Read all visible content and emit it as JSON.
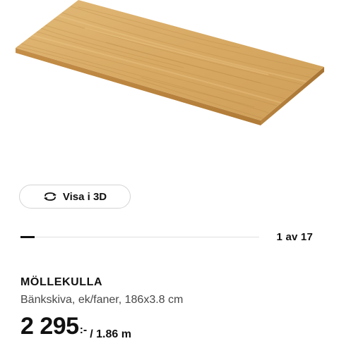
{
  "product_image": {
    "alt": "oak worktop"
  },
  "view_3d": {
    "label": "Visa i 3D",
    "icon": "rotate-3d-icon"
  },
  "carousel": {
    "counter": "1 av 17",
    "current": 1,
    "total": 17
  },
  "product": {
    "name": "MÖLLEKULLA",
    "description": "Bänkskiva, ek/faner, 186x3.8 cm",
    "price_amount": "2 295",
    "price_suffix": ":-",
    "price_unit": "/ 1.86 m"
  },
  "colors": {
    "text": "#111111",
    "muted_text": "#484848",
    "wood_light": "#dcb06a",
    "wood_mid": "#c99a52",
    "wood_edge": "#b88642"
  }
}
